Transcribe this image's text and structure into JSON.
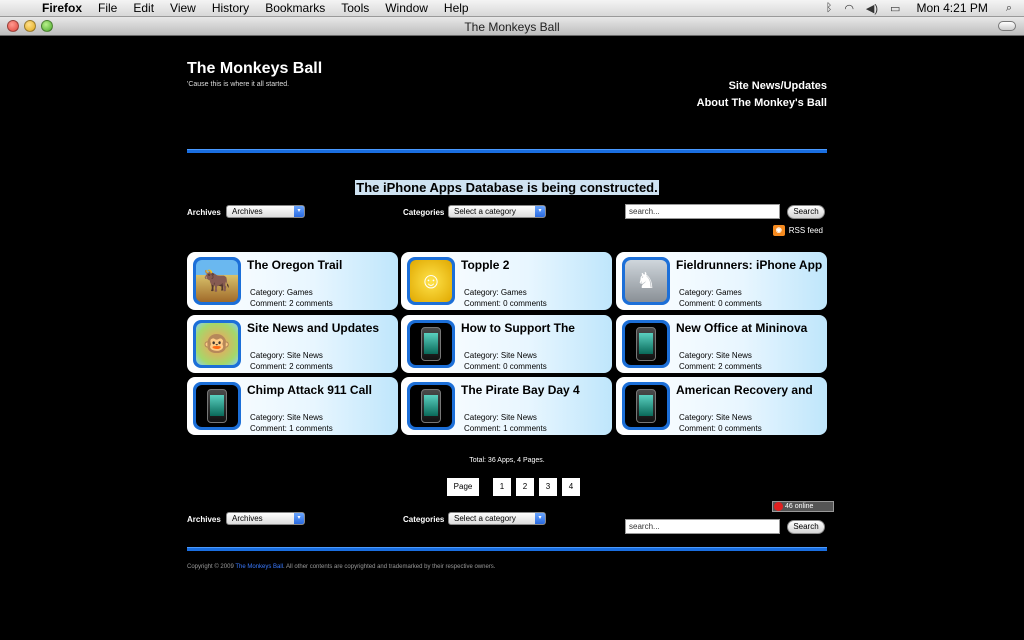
{
  "menubar": {
    "apple": "",
    "items": [
      "Firefox",
      "File",
      "Edit",
      "View",
      "History",
      "Bookmarks",
      "Tools",
      "Window",
      "Help"
    ],
    "clock": "Mon 4:21 PM"
  },
  "window": {
    "title": "The Monkeys Ball"
  },
  "site": {
    "title": "The Monkeys Ball",
    "tagline": "'Cause this is where it all started.",
    "nav": [
      "Site News/Updates",
      "About The Monkey's Ball"
    ]
  },
  "notice": "The iPhone Apps Database is being constructed.",
  "filters": {
    "archives_label": "Archives",
    "archives_value": "Archives",
    "categories_label": "Categories",
    "categories_value": "Select a category",
    "search_placeholder": "search...",
    "search_button": "Search"
  },
  "rss": {
    "icon": "rss-icon",
    "label": "RSS feed"
  },
  "apps": [
    {
      "name": "The Oregon Trail",
      "category": "Category: Games",
      "comments": "Comment: 2 comments",
      "thumb": "game1"
    },
    {
      "name": "Topple 2",
      "category": "Category: Games",
      "comments": "Comment: 0 comments",
      "thumb": "game2"
    },
    {
      "name": "Fieldrunners: iPhone App",
      "category": "Category: Games",
      "comments": "Comment: 0 comments",
      "thumb": "game3"
    },
    {
      "name": "Site News and Updates",
      "category": "Category: Site News",
      "comments": "Comment: 2 comments",
      "thumb": "site"
    },
    {
      "name": "How to Support The",
      "category": "Category: Site News",
      "comments": "Comment: 0 comments",
      "thumb": "phone"
    },
    {
      "name": "New Office at Mininova",
      "category": "Category: Site News",
      "comments": "Comment: 2 comments",
      "thumb": "phone"
    },
    {
      "name": "Chimp Attack 911 Call",
      "category": "Category: Site News",
      "comments": "Comment: 1 comments",
      "thumb": "phone"
    },
    {
      "name": "The Pirate Bay Day 4",
      "category": "Category: Site News",
      "comments": "Comment: 1 comments",
      "thumb": "phone"
    },
    {
      "name": "American Recovery and",
      "category": "Category: Site News",
      "comments": "Comment: 0 comments",
      "thumb": "phone"
    }
  ],
  "total": "Total: 36 Apps, 4 Pages.",
  "pager": {
    "label": "Page",
    "pages": [
      "1",
      "2",
      "3",
      "4"
    ]
  },
  "online_badge": {
    "count": "46",
    "text": "online"
  },
  "copyright": {
    "prefix": "Copyright © 2009",
    "link": "The Monkeys Ball",
    "suffix": ". All other contents are copyrighted and trademarked by their respective owners."
  },
  "colors": {
    "accent": "#1a6ee0",
    "notice_bg": "#cfe3f2",
    "card_edge": "#bfe6fb"
  }
}
